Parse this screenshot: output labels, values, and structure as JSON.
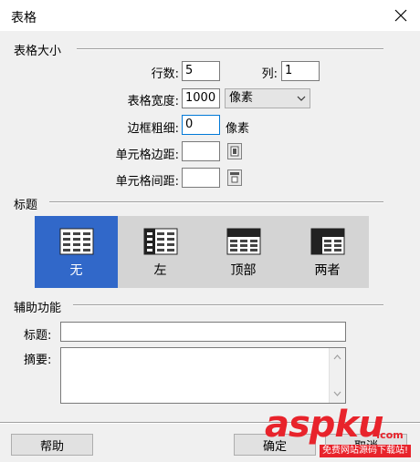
{
  "window": {
    "title": "表格"
  },
  "size_section": {
    "title": "表格大小",
    "rows_label": "行数:",
    "rows_value": "5",
    "cols_label": "列:",
    "cols_value": "1",
    "width_label": "表格宽度:",
    "width_value": "1000",
    "width_unit": "像素",
    "border_label": "边框粗细:",
    "border_value": "0",
    "border_unit": "像素",
    "padding_label": "单元格边距:",
    "padding_value": "",
    "spacing_label": "单元格间距:",
    "spacing_value": ""
  },
  "header_section": {
    "title": "标题",
    "options": [
      {
        "label": "无",
        "selected": true
      },
      {
        "label": "左",
        "selected": false
      },
      {
        "label": "顶部",
        "selected": false
      },
      {
        "label": "两者",
        "selected": false
      }
    ]
  },
  "access_section": {
    "title": "辅助功能",
    "caption_label": "标题:",
    "caption_value": "",
    "summary_label": "摘要:",
    "summary_value": ""
  },
  "buttons": {
    "help": "帮助",
    "ok": "确定",
    "cancel": "取消"
  },
  "watermark": {
    "brand": "aspku",
    "domain_suffix": ".com",
    "tagline": "免费网站源码下载站!"
  },
  "colors": {
    "selected": "#3168c9",
    "accent_focus": "#0078d7",
    "watermark": "#e8232b"
  }
}
